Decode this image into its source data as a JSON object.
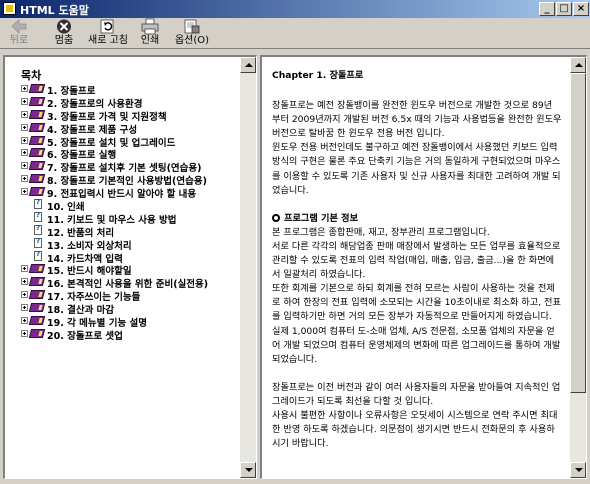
{
  "window": {
    "title": "HTML 도움말"
  },
  "toolbar": {
    "back_label": "뒤로",
    "hide_label": "멈춤",
    "refresh_label": "새로 고침",
    "print_label": "인쇄",
    "options_label": "옵션(O)"
  },
  "toc": {
    "title": "목차",
    "items": [
      {
        "label": "1. 장돌프로",
        "icon": "book-icon"
      },
      {
        "label": "2. 장돌프로의 사용환경",
        "icon": "book-icon"
      },
      {
        "label": "3. 장돌프로 가격 및 지원정책",
        "icon": "book-icon"
      },
      {
        "label": "4. 장돌프로 제품 구성",
        "icon": "book-icon"
      },
      {
        "label": "5. 장돌프로 설치 및 업그레이드",
        "icon": "book-icon"
      },
      {
        "label": "6. 장돌프로 실행",
        "icon": "book-icon"
      },
      {
        "label": "7. 장돌프로 설치후 기본 셋팅(연습용)",
        "icon": "book-icon"
      },
      {
        "label": "8. 장돌프로 기본적인 사용방법(연습용)",
        "icon": "book-icon"
      },
      {
        "label": "9. 전표입력시 반드시 알아야 할 내용",
        "icon": "book-icon"
      },
      {
        "label": "10. 인쇄",
        "icon": "page-icon"
      },
      {
        "label": "11. 키보드 및 마우스 사용 방법",
        "icon": "page-icon"
      },
      {
        "label": "12. 반품의 처리",
        "icon": "page-icon"
      },
      {
        "label": "13. 소비자 외상처리",
        "icon": "page-icon"
      },
      {
        "label": "14. 카드차액 입력",
        "icon": "page-icon"
      },
      {
        "label": "15. 반드시 해야할일",
        "icon": "book-icon"
      },
      {
        "label": "16. 본격적인 사용을 위한 준비(실전용)",
        "icon": "book-icon"
      },
      {
        "label": "17. 자주쓰이는 기능들",
        "icon": "book-icon"
      },
      {
        "label": "18. 결산과 마감",
        "icon": "book-icon"
      },
      {
        "label": "19. 각 메뉴별 기능 설명",
        "icon": "book-icon"
      },
      {
        "label": "20. 장돌프로 셋업",
        "icon": "book-icon"
      }
    ]
  },
  "content": {
    "heading": "Chapter 1. 장돌프로",
    "para1": "장돌프로는 예전 장돌뱅이를 완전한 윈도우 버전으로 개발한 것으로 89년 부터 2009년까지 개발된 버전 6.5x 때의 기능과 사용법등을 완전한 윈도우 버전으로 탈바꿈 한 윈도우 전용 버전 입니다.",
    "para2": "윈도우 전용 버전인데도 불구하고 예전 장돌뱅이에서 사용했던 키보드 입력방식의 구현은 물론 주요 단축키 기능은 거의 동일하게 구현되었으며 마우스를 이용할 수 있도록 기존 사용자 및 신규 사용자를 최대한 고려하여 개발 되었습니다.",
    "section_title": "프로그램 기본 정보",
    "para3": "본 프로그램은 종합판매, 재고, 장부관리 프로그램입니다.",
    "para4": "서로 다른 각각의 해당업종 판매 매장에서 발생하는 모든 업무를 효율적으로 관리할 수 있도록 전표의 입력 작업(매입, 매출, 입금, 출금...)을 한 화면에서 일괄처리 하였습니다.",
    "para5": "또한 회계를 기본으로 하되 회계를 전혀 모르는 사람이 사용하는 것을 전제로 하여 한장의 전표 입력에 소모되는 시간을 10초이내로 최소화 하고, 전표를 입력하기만 하면 거의 모든 장부가 자동적으로 만들어지게 하였습니다.",
    "para6": "실제 1,000여 컴퓨터 도-소매 업체, A/S 전문점, 소모품 업체의 자문을 얻어 개발 되었으며 컴퓨터 운영체제의 변화에 따른 업그레이드를 통하여 개발 되었습니다.",
    "para7": "장돌프로는 이전 버전과 같이 여러 사용자들의 자문을 받아들여 지속적인 업그레이드가 되도록 최선을 다할 것 입니다.",
    "para8": "사용시 불편한 사항이나 오류사항은 오딧세이 시스템으로 연락 주시면 최대한 반영 하도록 하겠습니다. 의문점이 생기시면 반드시 전화문의 후 사용하시기 바랍니다."
  }
}
